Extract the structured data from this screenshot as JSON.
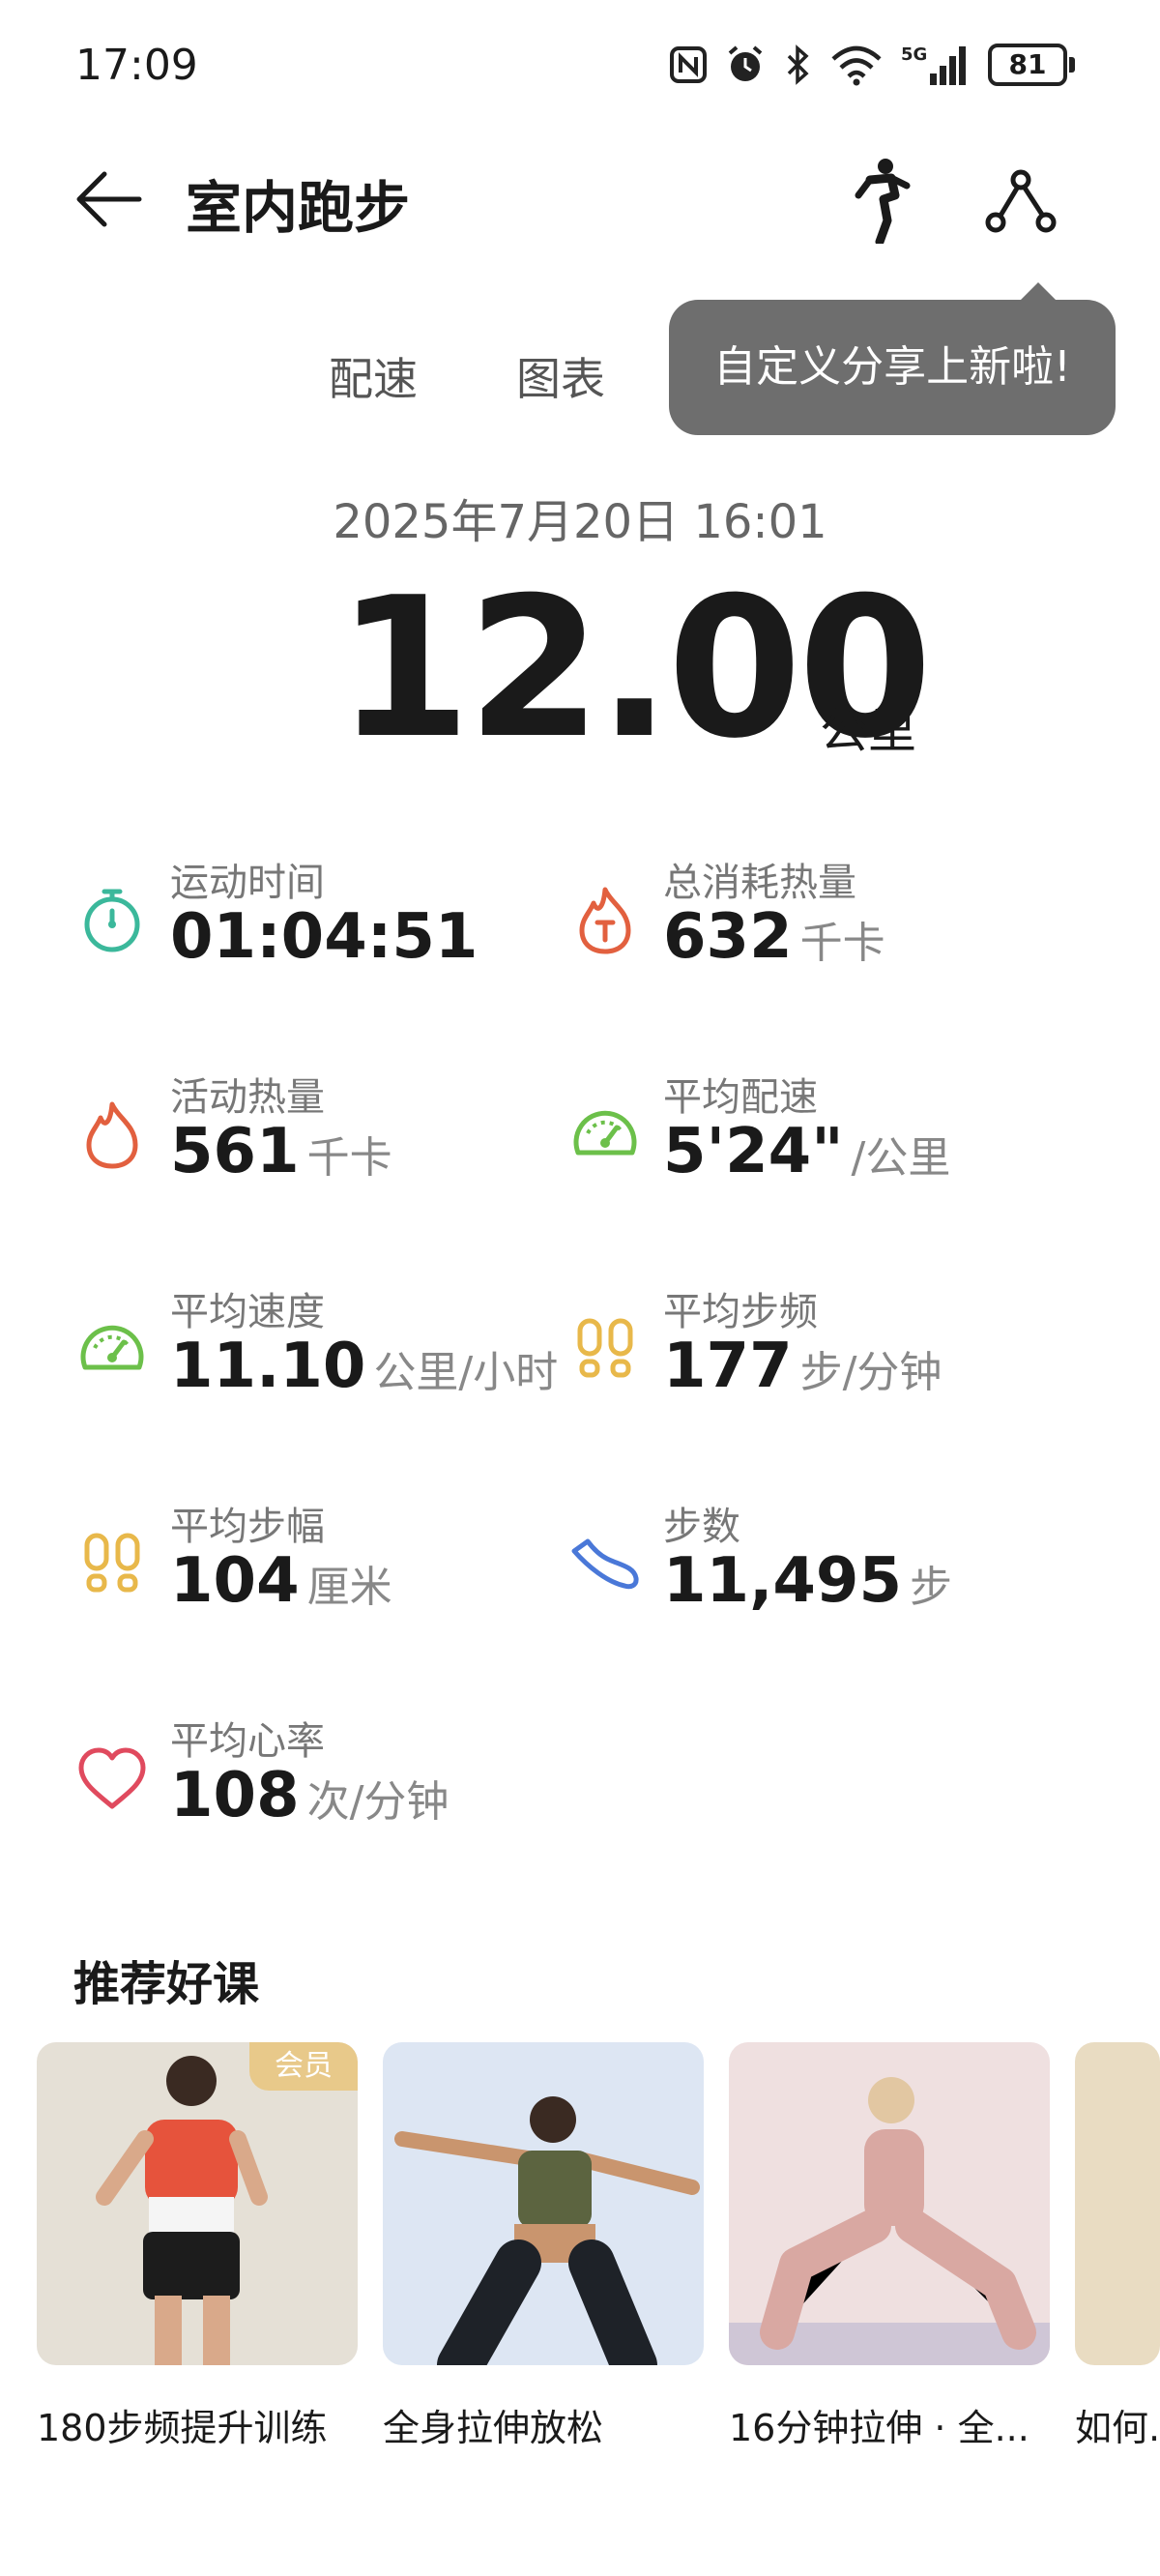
{
  "status_bar": {
    "time": "17:09",
    "battery": "81",
    "icons": [
      "nfc-icon",
      "alarm-icon",
      "bluetooth-icon",
      "wifi-icon",
      "signal-5g-icon",
      "battery-icon"
    ]
  },
  "header": {
    "title": "室内跑步",
    "back_icon": "arrow-left-icon",
    "runner_icon": "runner-icon",
    "share_icon": "share-icon"
  },
  "tabs": {
    "items": [
      {
        "label": "配速"
      },
      {
        "label": "图表"
      }
    ],
    "accent": "#d0433a"
  },
  "tooltip": {
    "text": "自定义分享上新啦!"
  },
  "summary": {
    "date": "2025年7月20日 16:01",
    "distance": "12.00",
    "distance_unit": "公里"
  },
  "metrics": [
    {
      "label": "运动时间",
      "value": "01:04:51",
      "unit": "",
      "icon": "stopwatch-icon",
      "color": "#3bb89b"
    },
    {
      "label": "总消耗热量",
      "value": "632",
      "unit": "千卡",
      "icon": "flame-total-icon",
      "color": "#e2603f"
    },
    {
      "label": "活动热量",
      "value": "561",
      "unit": "千卡",
      "icon": "flame-icon",
      "color": "#e2603f"
    },
    {
      "label": "平均配速",
      "value": "5'24\"",
      "unit": "/公里",
      "icon": "gauge-icon",
      "color": "#6cc04a"
    },
    {
      "label": "平均速度",
      "value": "11.10",
      "unit": "公里/小时",
      "icon": "speedometer-icon",
      "color": "#6cc04a"
    },
    {
      "label": "平均步频",
      "value": "177",
      "unit": "步/分钟",
      "icon": "footprints-icon",
      "color": "#e8b84a"
    },
    {
      "label": "平均步幅",
      "value": "104",
      "unit": "厘米",
      "icon": "footprints-icon",
      "color": "#e8b84a"
    },
    {
      "label": "步数",
      "value": "11,495",
      "unit": "步",
      "icon": "shoe-icon",
      "color": "#4a78d8"
    },
    {
      "label": "平均心率",
      "value": "108",
      "unit": "次/分钟",
      "icon": "heart-icon",
      "color": "#e04a5e"
    }
  ],
  "courses": {
    "title": "推荐好课",
    "items": [
      {
        "title": "180步频提升训练",
        "badge": "会员",
        "bg": "#e5e0d6"
      },
      {
        "title": "全身拉伸放松",
        "badge": "",
        "bg": "#dde6f3"
      },
      {
        "title": "16分钟拉伸 · 全...",
        "badge": "",
        "bg": "#efe0e0"
      },
      {
        "title": "如何...",
        "badge": "",
        "bg": "#e9dcc2"
      }
    ]
  }
}
